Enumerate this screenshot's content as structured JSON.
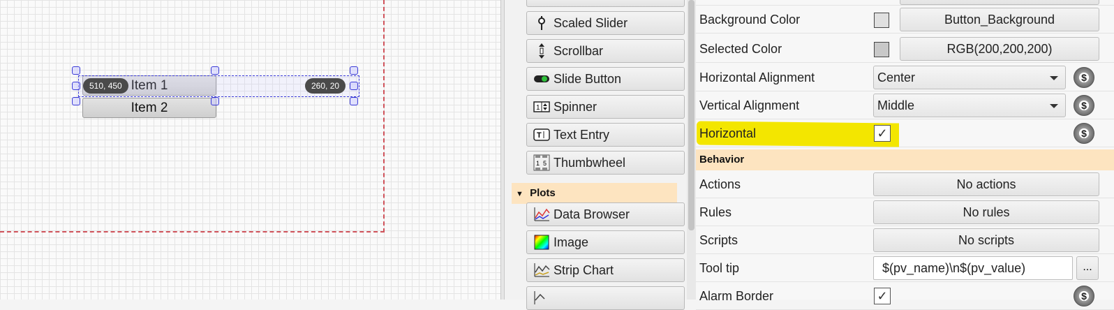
{
  "canvas": {
    "items": [
      "Item 1",
      "Item 2"
    ],
    "position_badge": "510, 450",
    "size_badge": "260, 20"
  },
  "palette": {
    "widgets": [
      {
        "label": "Scaled Slider",
        "icon": "scaled-slider-icon"
      },
      {
        "label": "Scrollbar",
        "icon": "scrollbar-icon"
      },
      {
        "label": "Slide Button",
        "icon": "slide-button-icon"
      },
      {
        "label": "Spinner",
        "icon": "spinner-icon"
      },
      {
        "label": "Text Entry",
        "icon": "text-entry-icon"
      },
      {
        "label": "Thumbwheel",
        "icon": "thumbwheel-icon"
      }
    ],
    "section_plots": "Plots",
    "plots": [
      {
        "label": "Data Browser",
        "icon": "data-browser-icon"
      },
      {
        "label": "Image",
        "icon": "image-icon"
      },
      {
        "label": "Strip Chart",
        "icon": "strip-chart-icon"
      }
    ]
  },
  "properties": {
    "background_color": {
      "label": "Background Color",
      "value": "Button_Background",
      "swatch": "#e0e0e0"
    },
    "selected_color": {
      "label": "Selected Color",
      "value": "RGB(200,200,200)",
      "swatch": "#c8c8c8"
    },
    "horizontal_alignment": {
      "label": "Horizontal Alignment",
      "value": "Center"
    },
    "vertical_alignment": {
      "label": "Vertical Alignment",
      "value": "Middle"
    },
    "horizontal": {
      "label": "Horizontal",
      "checked": true,
      "check_glyph": "✓"
    },
    "behavior_section": "Behavior",
    "actions": {
      "label": "Actions",
      "value": "No actions"
    },
    "rules": {
      "label": "Rules",
      "value": "No rules"
    },
    "scripts": {
      "label": "Scripts",
      "value": "No scripts"
    },
    "tooltip": {
      "label": "Tool tip",
      "value": "$(pv_name)\\n$(pv_value)",
      "more": "..."
    },
    "alarm_border": {
      "label": "Alarm Border",
      "checked": true
    }
  },
  "colors": {
    "highlight": "#f3e600",
    "section_bg": "#fde4c0",
    "selection": "#3a3ad6",
    "boundary": "#d0535b"
  }
}
